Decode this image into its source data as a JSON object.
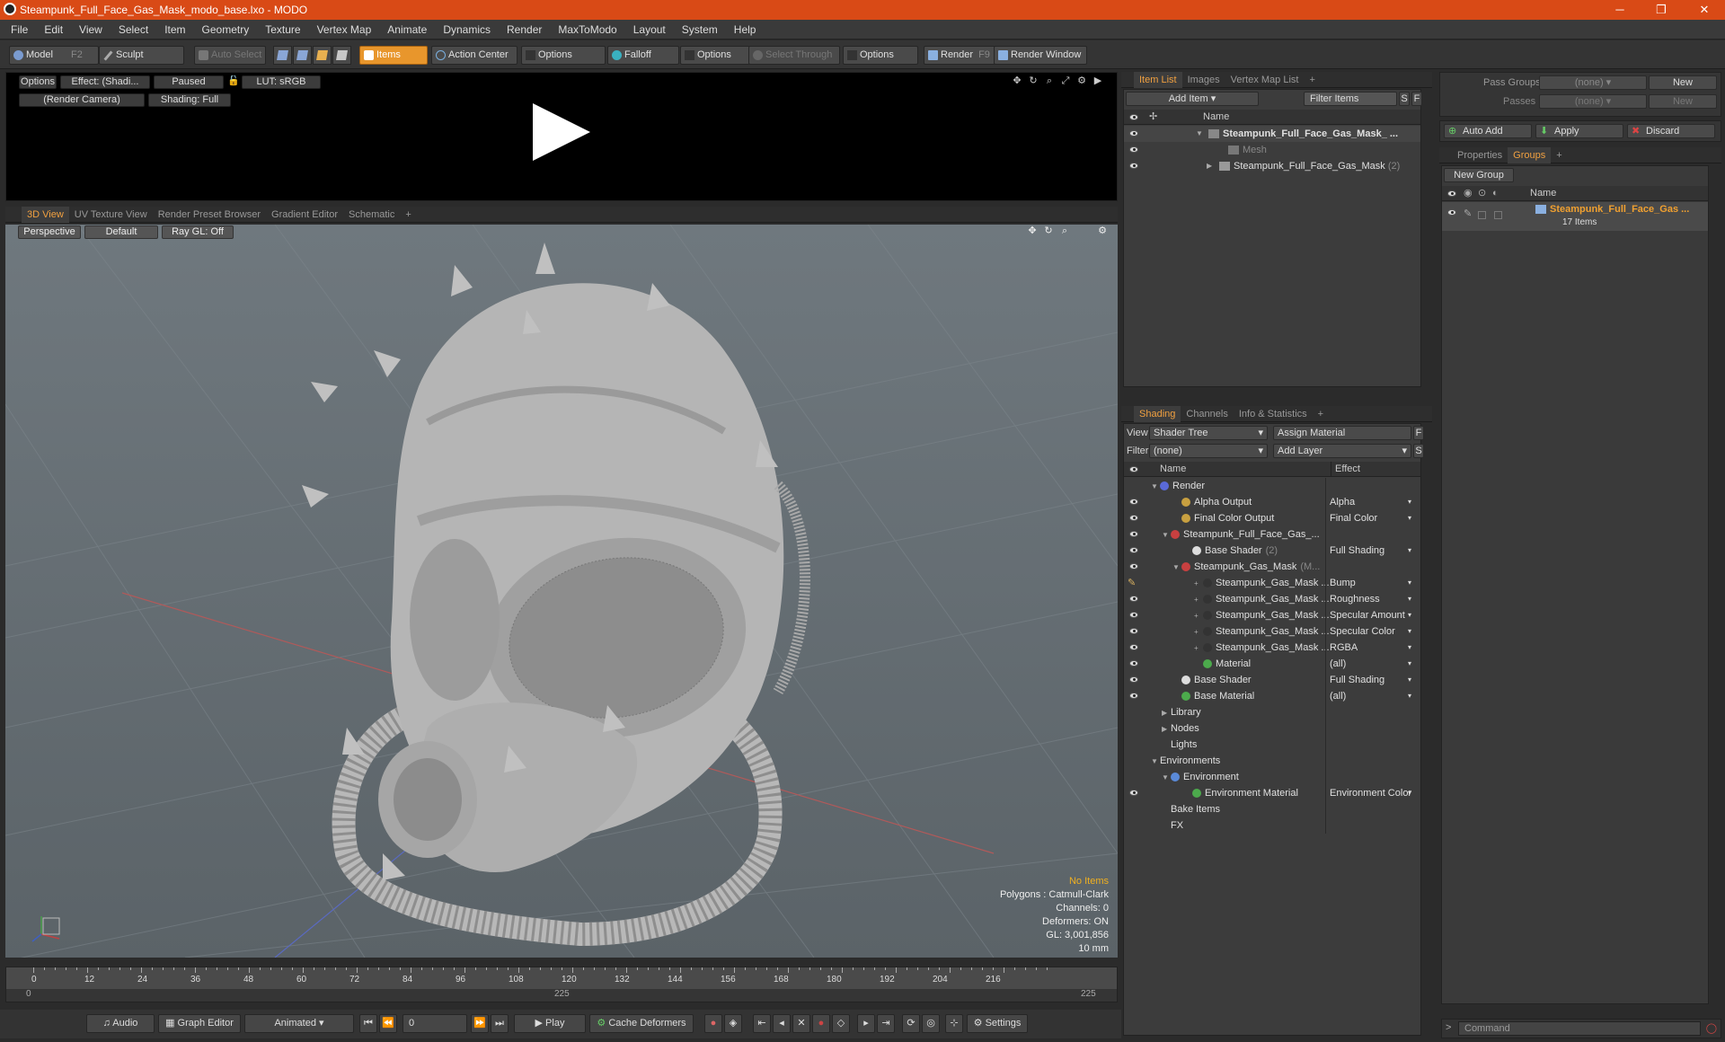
{
  "titlebar": {
    "title": "Steampunk_Full_Face_Gas_Mask_modo_base.lxo - MODO",
    "minimize": "─",
    "maximize": "❐",
    "close": "✕"
  },
  "menu": [
    "File",
    "Edit",
    "View",
    "Select",
    "Item",
    "Geometry",
    "Texture",
    "Vertex Map",
    "Animate",
    "Dynamics",
    "Render",
    "MaxToModo",
    "Layout",
    "System",
    "Help"
  ],
  "toolbar": {
    "model": "Model",
    "model_key": "F2",
    "sculpt": "Sculpt",
    "auto_select": "Auto Select",
    "items": "Items",
    "action_center": "Action Center",
    "options1": "Options",
    "falloff": "Falloff",
    "options2": "Options",
    "select_through": "Select Through",
    "options3": "Options",
    "render": "Render",
    "render_key": "F9",
    "render_window": "Render Window"
  },
  "preview": {
    "options": "Options",
    "effect": "Effect: (Shadi...",
    "paused": "Paused",
    "lut": "LUT: sRGB",
    "camera": "(Render Camera)",
    "shading": "Shading: Full"
  },
  "viewtabs": [
    "3D View",
    "UV Texture View",
    "Render Preset Browser",
    "Gradient Editor",
    "Schematic",
    "+"
  ],
  "viewport": {
    "perspective": "Perspective",
    "default": "Default",
    "raygl": "Ray GL: Off",
    "info": {
      "no_items": "No Items",
      "polygons": "Polygons : Catmull-Clark",
      "channels": "Channels: 0",
      "deformers": "Deformers: ON",
      "gl": "GL: 3,001,856",
      "scale": "10 mm"
    }
  },
  "timeline": {
    "ticks": [
      "0",
      "12",
      "24",
      "36",
      "48",
      "60",
      "72",
      "84",
      "96",
      "108",
      "120",
      "132",
      "144",
      "156",
      "168",
      "180",
      "192",
      "204",
      "216"
    ],
    "start": "0",
    "mid": "225",
    "end": "225"
  },
  "bottombar": {
    "audio": "Audio",
    "graph_editor": "Graph Editor",
    "animated": "Animated",
    "frame": "0",
    "play": "Play",
    "cache_deformers": "Cache Deformers",
    "settings": "Settings"
  },
  "itemlist": {
    "tabs": [
      "Item List",
      "Images",
      "Vertex Map List",
      "+"
    ],
    "add_item": "Add Item",
    "filter_items": "Filter Items",
    "s": "S",
    "f": "F",
    "col_name": "Name",
    "rows": [
      {
        "label": "Steampunk_Full_Face_Gas_Mask_ ...",
        "bold": true
      },
      {
        "label": "Mesh",
        "dim": true
      },
      {
        "label": "Steampunk_Full_Face_Gas_Mask",
        "suffix": "(2)"
      }
    ]
  },
  "shading": {
    "tabs": [
      "Shading",
      "Channels",
      "Info & Statistics",
      "+"
    ],
    "view_label": "View",
    "view_value": "Shader Tree",
    "assign_material": "Assign Material",
    "f": "F",
    "filter_label": "Filter",
    "filter_value": "(none)",
    "add_layer": "Add Layer",
    "s": "S",
    "col_name": "Name",
    "col_effect": "Effect",
    "rows": [
      {
        "label": "Render",
        "effect": "",
        "indent": 0,
        "color": "#5a6ad8",
        "exp": "▼",
        "eye": false
      },
      {
        "label": "Alpha Output",
        "effect": "Alpha",
        "indent": 2,
        "color": "#c8a040",
        "exp": "",
        "eye": true
      },
      {
        "label": "Final Color Output",
        "effect": "Final Color",
        "indent": 2,
        "color": "#c8a040",
        "exp": "",
        "eye": true
      },
      {
        "label": "Steampunk_Full_Face_Gas_...",
        "effect": "",
        "indent": 1,
        "color": "#c84040",
        "exp": "▼",
        "eye": true
      },
      {
        "label": "Base Shader",
        "suffix": "(2)",
        "effect": "Full Shading",
        "indent": 3,
        "color": "#dddddd",
        "exp": "",
        "eye": true
      },
      {
        "label": "Steampunk_Gas_Mask",
        "suffix": "(M...",
        "effect": "",
        "indent": 2,
        "color": "#c84040",
        "exp": "▼",
        "eye": true
      },
      {
        "label": "Steampunk_Gas_Mask ...",
        "effect": "Bump",
        "indent": 4,
        "color": "#333333",
        "exp": "+",
        "eye": false,
        "brush": true
      },
      {
        "label": "Steampunk_Gas_Mask ...",
        "effect": "Roughness",
        "indent": 4,
        "color": "#333333",
        "exp": "+",
        "eye": true
      },
      {
        "label": "Steampunk_Gas_Mask ...",
        "effect": "Specular Amount",
        "indent": 4,
        "color": "#333333",
        "exp": "+",
        "eye": true
      },
      {
        "label": "Steampunk_Gas_Mask ...",
        "effect": "Specular Color",
        "indent": 4,
        "color": "#333333",
        "exp": "+",
        "eye": true
      },
      {
        "label": "Steampunk_Gas_Mask ...",
        "effect": "RGBA",
        "indent": 4,
        "color": "#333333",
        "exp": "+",
        "eye": true
      },
      {
        "label": "Material",
        "effect": "(all)",
        "indent": 4,
        "color": "#4caa4c",
        "exp": "",
        "eye": true
      },
      {
        "label": "Base Shader",
        "effect": "Full Shading",
        "indent": 2,
        "color": "#dddddd",
        "exp": "",
        "eye": true
      },
      {
        "label": "Base Material",
        "effect": "(all)",
        "indent": 2,
        "color": "#4caa4c",
        "exp": "",
        "eye": true
      },
      {
        "label": "Library",
        "effect": "",
        "indent": 1,
        "color": "",
        "exp": "▶",
        "eye": false
      },
      {
        "label": "Nodes",
        "effect": "",
        "indent": 1,
        "color": "",
        "exp": "▶",
        "eye": false
      },
      {
        "label": "Lights",
        "effect": "",
        "indent": 1,
        "color": "",
        "exp": "",
        "eye": false
      },
      {
        "label": "Environments",
        "effect": "",
        "indent": 0,
        "color": "",
        "exp": "▼",
        "eye": false
      },
      {
        "label": "Environment",
        "effect": "",
        "indent": 1,
        "color": "#5a8ad8",
        "exp": "▼",
        "eye": false
      },
      {
        "label": "Environment Material",
        "effect": "Environment Color",
        "indent": 3,
        "color": "#4caa4c",
        "exp": "",
        "eye": true
      },
      {
        "label": "Bake Items",
        "effect": "",
        "indent": 1,
        "color": "",
        "exp": "",
        "eye": false
      },
      {
        "label": "FX",
        "effect": "",
        "indent": 1,
        "color": "",
        "exp": "",
        "eye": false
      }
    ]
  },
  "groups": {
    "pass_groups_label": "Pass Groups",
    "pass_groups_value": "(none)",
    "new": "New",
    "passes_label": "Passes",
    "passes_value": "(none)",
    "new2": "New",
    "auto_add": "Auto Add",
    "apply": "Apply",
    "discard": "Discard",
    "tabs": [
      "Properties",
      "Groups",
      "+"
    ],
    "new_group": "New Group",
    "col_name": "Name",
    "group_name": "Steampunk_Full_Face_Gas ...",
    "group_count": "17 Items",
    "command_placeholder": "Command"
  }
}
